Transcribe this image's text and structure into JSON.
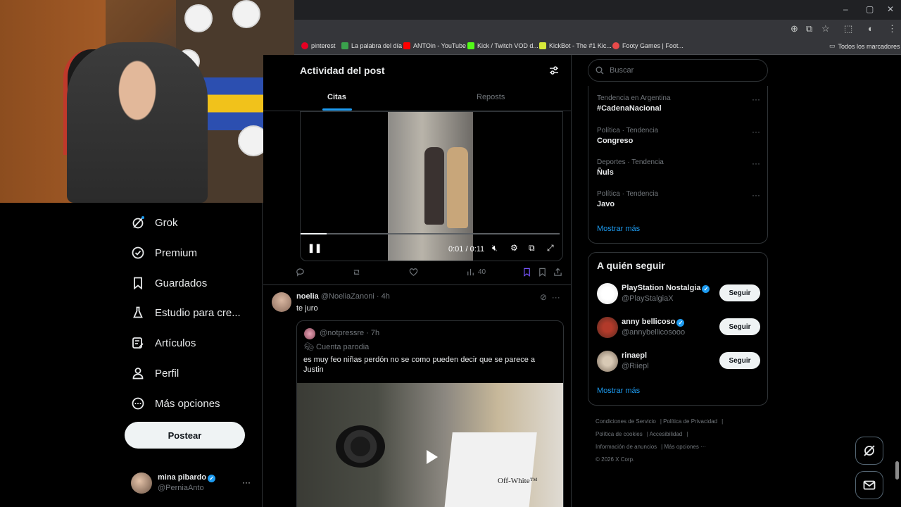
{
  "browser": {
    "window_controls": [
      "–",
      "▢",
      "✕"
    ],
    "bookmarks": [
      {
        "label": "pinterest",
        "color": "#e60023"
      },
      {
        "label": "La palabra del día",
        "color": "#3aa14c"
      },
      {
        "label": "ANTOin - YouTube",
        "color": "#ff0000"
      },
      {
        "label": "Kick / Twitch VOD d...",
        "color": "#53fc18"
      },
      {
        "label": "KickBot - The #1 Kic...",
        "color": "#d7e93a"
      },
      {
        "label": "Footy Games | Foot...",
        "color": "#e84a4a"
      }
    ],
    "all_bookmarks": "Todos los marcadores"
  },
  "nav": {
    "items": [
      {
        "label": "Grok",
        "icon": "grok-icon"
      },
      {
        "label": "Premium",
        "icon": "premium-icon"
      },
      {
        "label": "Guardados",
        "icon": "bookmark-icon"
      },
      {
        "label": "Estudio para cre...",
        "icon": "flask-icon"
      },
      {
        "label": "Artículos",
        "icon": "article-icon"
      },
      {
        "label": "Perfil",
        "icon": "profile-icon"
      },
      {
        "label": "Más opciones",
        "icon": "more-icon"
      }
    ],
    "post_button": "Postear",
    "account": {
      "name": "mina pibardo",
      "handle": "@PerniaAnto",
      "more": "···"
    }
  },
  "center": {
    "title": "Actividad del post",
    "tabs": [
      "Citas",
      "Reposts"
    ],
    "video": {
      "time": "0:01 / 0:11",
      "progress": 0.1
    },
    "actions": {
      "views": "40"
    },
    "post2": {
      "name": "noelia",
      "handle": "@NoeliaZanoni",
      "time": "· 4h",
      "text": "te juro",
      "quote": {
        "handle": "@notpressre · 7h",
        "label": "Cuenta parodia",
        "text": "es muy feo niñas perdón no se como pueden decir que se parece a Justin",
        "bag_brand": "Off-White™"
      }
    }
  },
  "right": {
    "search_placeholder": "Buscar",
    "trends": [
      {
        "context": "Tendencia en Argentina",
        "title": "#CadenaNacional"
      },
      {
        "context": "Política · Tendencia",
        "title": "Congreso"
      },
      {
        "context": "Deportes · Tendencia",
        "title": "Ñuls"
      },
      {
        "context": "Política · Tendencia",
        "title": "Javo"
      }
    ],
    "show_more": "Mostrar más",
    "follow_title": "A quién seguir",
    "follow_users": [
      {
        "name": "PlayStation Nostalgia",
        "handle": "@PlayStalgiaX",
        "verified": true
      },
      {
        "name": "anny bellicoso",
        "handle": "@annybellicosooo",
        "verified": true
      },
      {
        "name": "rinaepl",
        "handle": "@Riiepl",
        "verified": false
      }
    ],
    "follow_button": "Seguir",
    "footer": {
      "links": [
        "Condiciones de Servicio",
        "Política de Privacidad",
        "Política de cookies",
        "Accesibilidad",
        "Información de anuncios",
        "Más opciones ···"
      ],
      "copyright": "© 2026 X Corp."
    }
  }
}
